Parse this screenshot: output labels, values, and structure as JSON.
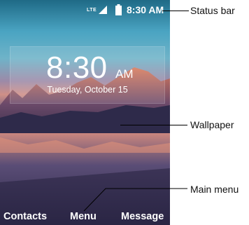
{
  "status_bar": {
    "network": "LTE",
    "time": "8:30 AM",
    "icons": [
      "signal-icon",
      "battery-icon"
    ]
  },
  "lock_screen": {
    "clock_time": "8:30",
    "clock_ampm": "AM",
    "date": "Tuesday, October 15"
  },
  "softkeys": {
    "left": "Contacts",
    "center": "Menu",
    "right": "Message"
  },
  "callouts": {
    "status_bar": "Status bar",
    "wallpaper": "Wallpaper",
    "main_menu": "Main menu"
  }
}
